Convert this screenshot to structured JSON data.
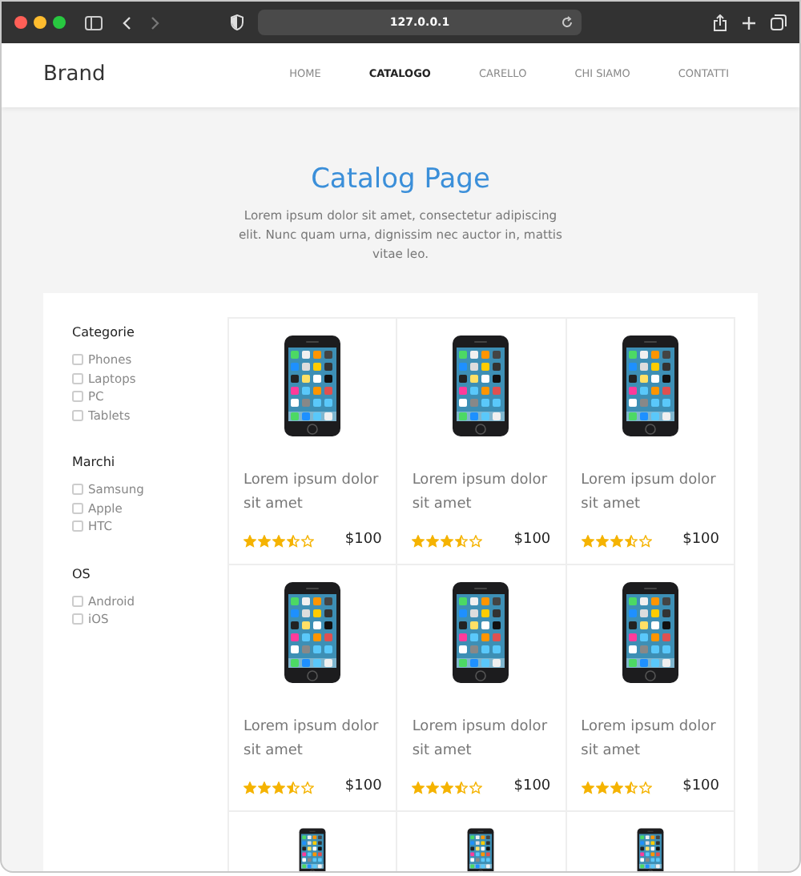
{
  "browser": {
    "url": "127.0.0.1"
  },
  "header": {
    "brand": "Brand",
    "nav": [
      {
        "label": "HOME",
        "selected": false
      },
      {
        "label": "CATALOGO",
        "selected": true
      },
      {
        "label": "CARELLO",
        "selected": false
      },
      {
        "label": "CHI SIAMO",
        "selected": false
      },
      {
        "label": "CONTATTI",
        "selected": false
      }
    ]
  },
  "hero": {
    "title": "Catalog Page",
    "text": "Lorem ipsum dolor sit amet, consectetur adipiscing elit. Nunc quam urna, dignissim nec auctor in, mattis vitae leo."
  },
  "filters": [
    {
      "title": "Categorie",
      "options": [
        {
          "label": "Phones",
          "checked": false
        },
        {
          "label": "Laptops",
          "checked": false
        },
        {
          "label": "PC",
          "checked": false
        },
        {
          "label": "Tablets",
          "checked": false
        }
      ]
    },
    {
      "title": "Marchi",
      "options": [
        {
          "label": "Samsung",
          "checked": false
        },
        {
          "label": "Apple",
          "checked": false
        },
        {
          "label": "HTC",
          "checked": false
        }
      ]
    },
    {
      "title": "OS",
      "options": [
        {
          "label": "Android",
          "checked": false
        },
        {
          "label": "iOS",
          "checked": false
        }
      ]
    }
  ],
  "products": [
    {
      "kind": "full",
      "title": "Lorem ipsum dolor sit amet",
      "stars": 3.5,
      "price": "$100"
    },
    {
      "kind": "full",
      "title": "Lorem ipsum dolor sit amet",
      "stars": 3.5,
      "price": "$100"
    },
    {
      "kind": "full",
      "title": "Lorem ipsum dolor sit amet",
      "stars": 3.5,
      "price": "$100"
    },
    {
      "kind": "full",
      "title": "Lorem ipsum dolor sit amet",
      "stars": 3.5,
      "price": "$100"
    },
    {
      "kind": "full",
      "title": "Lorem ipsum dolor sit amet",
      "stars": 3.5,
      "price": "$100"
    },
    {
      "kind": "full",
      "title": "Lorem ipsum dolor sit amet",
      "stars": 3.5,
      "price": "$100"
    },
    {
      "kind": "cut"
    },
    {
      "kind": "cut"
    },
    {
      "kind": "cut"
    }
  ]
}
